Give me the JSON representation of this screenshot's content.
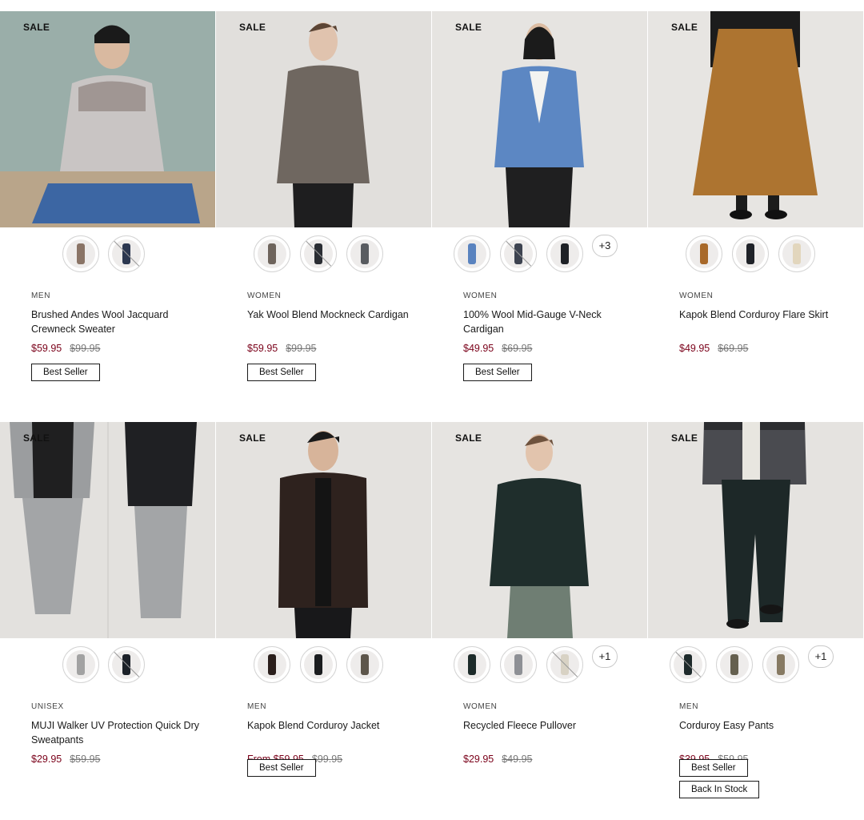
{
  "products": [
    {
      "sale": "SALE",
      "category": "MEN",
      "name": "Brushed Andes Wool Jacquard Crewneck Sweater",
      "price": "$59.95",
      "original": "$99.95",
      "badges": [
        "Best Seller"
      ],
      "swatches": [
        {
          "color": "#8a7466",
          "crossed": false
        },
        {
          "color": "#2c3850",
          "crossed": true
        }
      ],
      "more": ""
    },
    {
      "sale": "SALE",
      "category": "WOMEN",
      "name": "Yak Wool Blend Mockneck Cardigan",
      "price": "$59.95",
      "original": "$99.95",
      "badges": [
        "Best Seller"
      ],
      "swatches": [
        {
          "color": "#6e645c",
          "crossed": false
        },
        {
          "color": "#2a2d33",
          "crossed": true
        },
        {
          "color": "#595c60",
          "crossed": false
        }
      ],
      "more": ""
    },
    {
      "sale": "SALE",
      "category": "WOMEN",
      "name": "100% Wool Mid-Gauge V-Neck Cardigan",
      "price": "$49.95",
      "original": "$69.95",
      "badges": [
        "Best Seller"
      ],
      "swatches": [
        {
          "color": "#5a83bf",
          "crossed": false
        },
        {
          "color": "#3d4350",
          "crossed": true
        },
        {
          "color": "#1e2126",
          "crossed": false
        }
      ],
      "more": "+3"
    },
    {
      "sale": "SALE",
      "category": "WOMEN",
      "name": "Kapok Blend Corduroy Flare Skirt",
      "price": "$49.95",
      "original": "$69.95",
      "badges": [],
      "swatches": [
        {
          "color": "#a8692a",
          "crossed": false
        },
        {
          "color": "#1f2228",
          "crossed": false
        },
        {
          "color": "#e2d6bd",
          "crossed": false
        }
      ],
      "more": ""
    },
    {
      "sale": "SALE",
      "category": "UNISEX",
      "name": "MUJI Walker UV Protection Quick Dry Sweatpants",
      "price": "$29.95",
      "original": "$59.95",
      "badges": [],
      "swatches": [
        {
          "color": "#a2a2a2",
          "crossed": false
        },
        {
          "color": "#1c2128",
          "crossed": true
        }
      ],
      "more": ""
    },
    {
      "sale": "SALE",
      "category": "MEN",
      "name": "Kapok Blend Corduroy Jacket",
      "price": "From $59.95",
      "original": "$99.95",
      "badges": [
        "Best Seller"
      ],
      "swatches": [
        {
          "color": "#2b1f1c",
          "crossed": false
        },
        {
          "color": "#1b1d1f",
          "crossed": false
        },
        {
          "color": "#5d564b",
          "crossed": false
        }
      ],
      "more": ""
    },
    {
      "sale": "SALE",
      "category": "WOMEN",
      "name": "Recycled Fleece Pullover",
      "price": "$29.95",
      "original": "$49.95",
      "badges": [],
      "swatches": [
        {
          "color": "#1d2b2a",
          "crossed": false
        },
        {
          "color": "#8e9095",
          "crossed": false
        },
        {
          "color": "#d8d2c4",
          "crossed": true
        }
      ],
      "more": "+1"
    },
    {
      "sale": "SALE",
      "category": "MEN",
      "name": "Corduroy Easy Pants",
      "price": "$39.95",
      "original": "$59.95",
      "badges": [
        "Best Seller",
        "Back In Stock"
      ],
      "swatches": [
        {
          "color": "#1e2a2b",
          "crossed": true
        },
        {
          "color": "#65604f",
          "crossed": false
        },
        {
          "color": "#877a63",
          "crossed": false
        }
      ],
      "more": "+1"
    }
  ],
  "colors": {
    "sale_price": "#7a0019",
    "original_price": "#777777",
    "text": "#1a1a1a"
  }
}
